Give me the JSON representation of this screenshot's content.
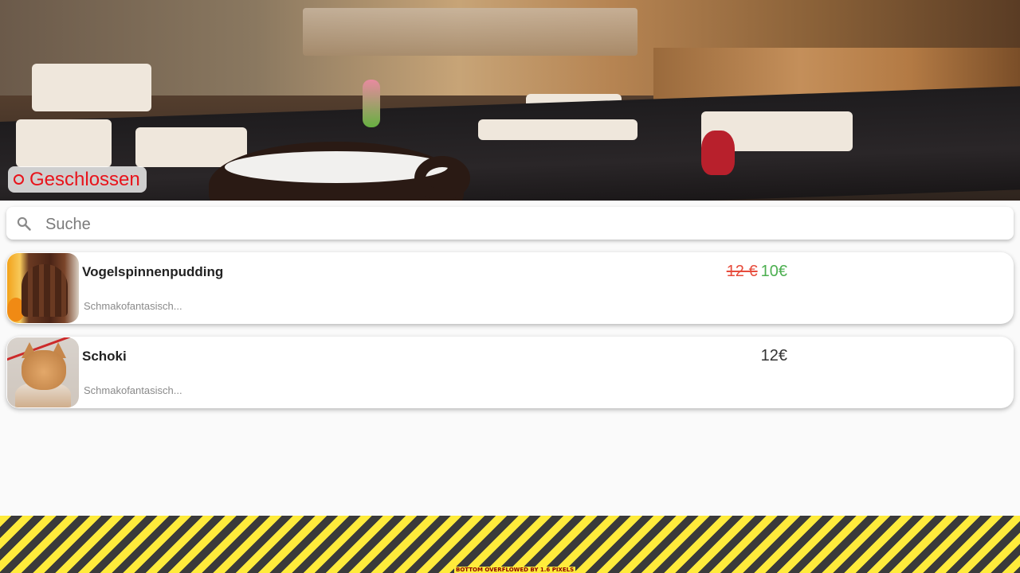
{
  "status": {
    "label": "Geschlossen",
    "color": "#e8131b"
  },
  "search": {
    "placeholder": "Suche"
  },
  "items": [
    {
      "name": "Vogelspinnenpudding",
      "description": "Schmakofantasisch...",
      "price_old": "12 €",
      "price_new": "10€"
    },
    {
      "name": "Schoki",
      "description": "Schmakofantasisch...",
      "price": "12€"
    }
  ],
  "debug": {
    "overflow_text": "BOTTOM OVERFLOWED BY 1.6 PIXELS"
  },
  "colors": {
    "sale_old": "#e74c3c",
    "sale_new": "#4caf50",
    "overflow_yellow": "#ffeb3b"
  }
}
